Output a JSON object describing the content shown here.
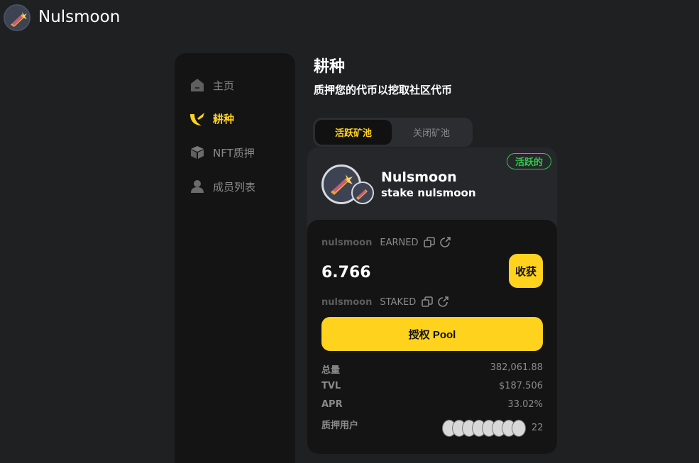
{
  "app": {
    "title": "Nulsmoon",
    "logo_icon": "nulsmoon-logo"
  },
  "sidebar": {
    "items": [
      {
        "label": "主页",
        "icon": "home-icon",
        "active": false
      },
      {
        "label": "耕种",
        "icon": "farm-icon",
        "active": true
      },
      {
        "label": "NFT质押",
        "icon": "nft-box-icon",
        "active": false
      },
      {
        "label": "成员列表",
        "icon": "member-icon",
        "active": false
      }
    ]
  },
  "header": {
    "title": "耕种",
    "subtitle": "质押您的代币以挖取社区代币"
  },
  "tabs": [
    {
      "label": "活跃矿池",
      "active": true
    },
    {
      "label": "关闭矿池",
      "active": false
    }
  ],
  "pool": {
    "status": "活跃的",
    "name": "Nulsmoon",
    "description": "stake nulsmoon",
    "earned_token": "nulsmoon",
    "earned_label": "EARNED",
    "earned_value": "6.766",
    "harvest_label": "收获",
    "staked_token": "nulsmoon",
    "staked_label": "STAKED",
    "approve_label": "授权 Pool",
    "stats": [
      {
        "key": "总量",
        "value": "382,061.88"
      },
      {
        "key": "TVL",
        "value": "$187.506"
      },
      {
        "key": "APR",
        "value": "33.02%"
      }
    ],
    "stakers_label": "质押用户",
    "stakers_count": "22"
  },
  "colors": {
    "background": "#1f2022",
    "accent": "#ffd21e",
    "active_badge": "#31c84b",
    "panel": "#141414",
    "card": "#26272a"
  }
}
